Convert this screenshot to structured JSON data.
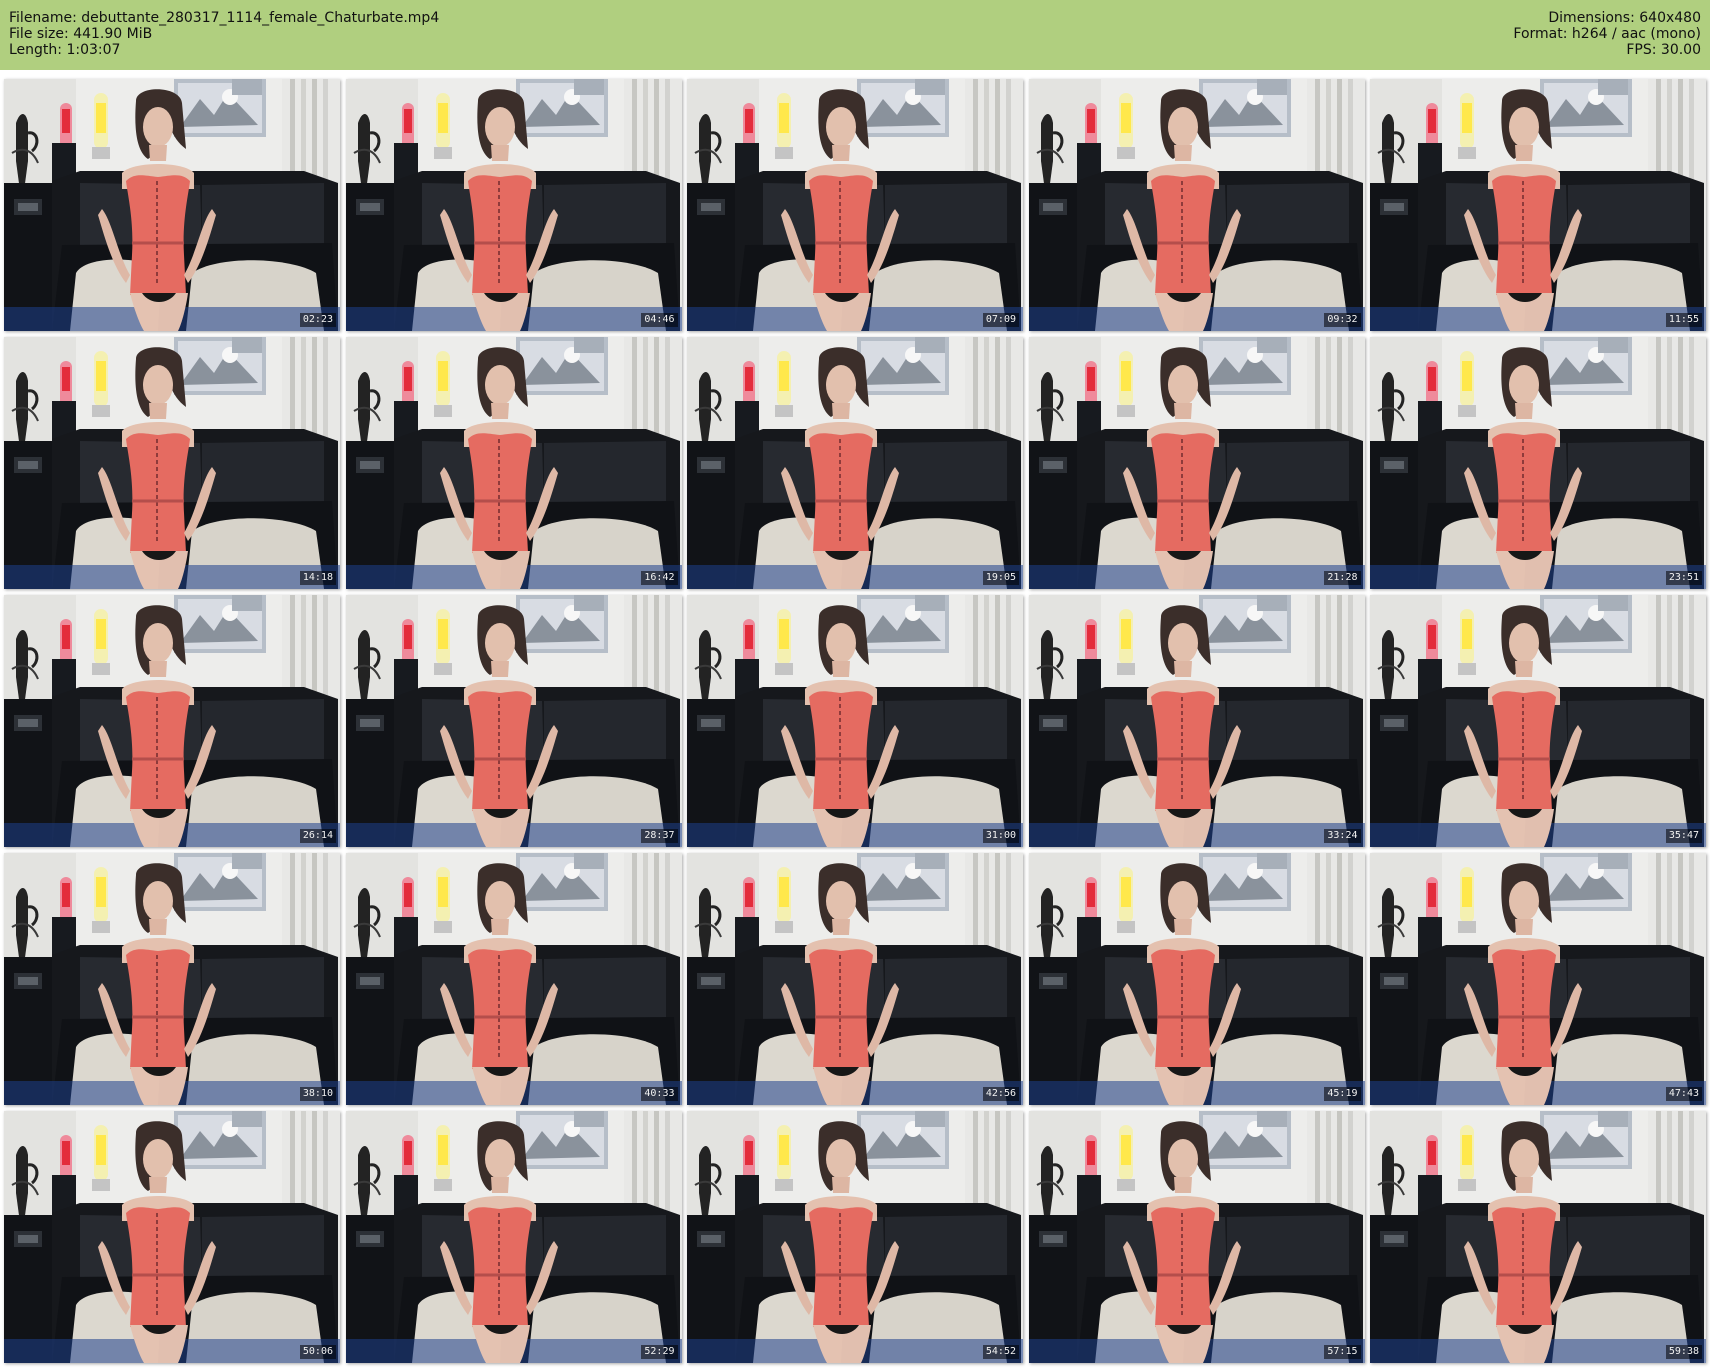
{
  "header": {
    "left": [
      "Filename: debuttante_280317_1114_female_Chaturbate.mp4",
      "File size: 441.90 MiB",
      "Length: 1:03:07"
    ],
    "right": [
      "Dimensions: 640x480",
      "Format: h264 / aac (mono)",
      "FPS: 30.00"
    ]
  },
  "thumbnails": [
    {
      "time": "02:23"
    },
    {
      "time": "04:46"
    },
    {
      "time": "07:09"
    },
    {
      "time": "09:32"
    },
    {
      "time": "11:55"
    },
    {
      "time": "14:18"
    },
    {
      "time": "16:42"
    },
    {
      "time": "19:05"
    },
    {
      "time": "21:28"
    },
    {
      "time": "23:51"
    },
    {
      "time": "26:14"
    },
    {
      "time": "28:37"
    },
    {
      "time": "31:00"
    },
    {
      "time": "33:24"
    },
    {
      "time": "35:47"
    },
    {
      "time": "38:10"
    },
    {
      "time": "40:33"
    },
    {
      "time": "42:56"
    },
    {
      "time": "45:19"
    },
    {
      "time": "47:43"
    },
    {
      "time": "50:06"
    },
    {
      "time": "52:29"
    },
    {
      "time": "54:52"
    },
    {
      "time": "57:15"
    },
    {
      "time": "59:38"
    }
  ],
  "colors": {
    "header_bg": "#b0cf7f",
    "dress": "#e56b61",
    "sofa": "#16181c",
    "wall": "#ededeb"
  }
}
